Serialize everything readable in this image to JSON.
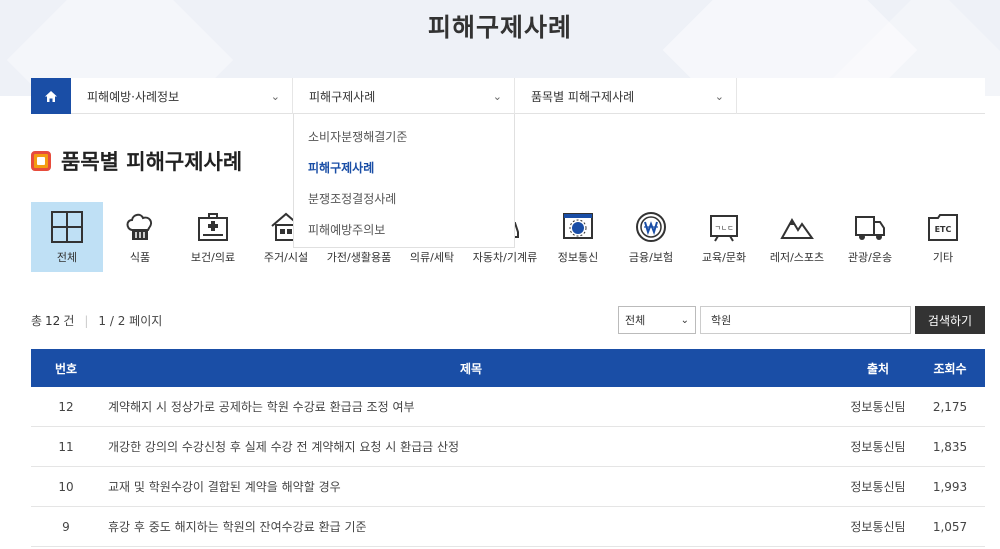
{
  "hero": {
    "title": "피해구제사례"
  },
  "breadcrumb": {
    "items": [
      {
        "label": "피해예방·사례정보"
      },
      {
        "label": "피해구제사례"
      },
      {
        "label": "품목별 피해구제사례"
      }
    ]
  },
  "dropdown": {
    "options": [
      {
        "label": "소비자분쟁해결기준"
      },
      {
        "label": "피해구제사례"
      },
      {
        "label": "분쟁조정결정사례"
      },
      {
        "label": "피해예방주의보"
      }
    ],
    "active_index": 1
  },
  "section": {
    "title": "품목별 피해구제사례"
  },
  "categories": [
    {
      "label": "전체",
      "icon": "grid-icon"
    },
    {
      "label": "식품",
      "icon": "chef-hat-icon"
    },
    {
      "label": "보건/의료",
      "icon": "medical-kit-icon"
    },
    {
      "label": "주거/시설",
      "icon": "house-icon"
    },
    {
      "label": "가전/생활용품",
      "icon": "appliance-icon"
    },
    {
      "label": "의류/세탁",
      "icon": "shirt-icon"
    },
    {
      "label": "자동차/기계류",
      "icon": "car-icon"
    },
    {
      "label": "정보통신",
      "icon": "monitor-icon"
    },
    {
      "label": "금융/보험",
      "icon": "won-coin-icon"
    },
    {
      "label": "교육/문화",
      "icon": "blackboard-icon"
    },
    {
      "label": "레저/스포츠",
      "icon": "mountain-icon"
    },
    {
      "label": "관광/운송",
      "icon": "truck-icon"
    },
    {
      "label": "기타",
      "icon": "etc-folder-icon"
    }
  ],
  "summary": {
    "total_prefix": "총",
    "total_count": "12",
    "total_suffix": "건",
    "page_info": "1 / 2 페이지"
  },
  "search": {
    "select_value": "전체",
    "input_value": "학원",
    "button_label": "검색하기"
  },
  "table": {
    "headers": {
      "no": "번호",
      "title": "제목",
      "source": "출처",
      "views": "조회수"
    },
    "rows": [
      {
        "no": "12",
        "title": "계약해지 시 정상가로 공제하는 학원 수강료 환급금 조정 여부",
        "source": "정보통신팀",
        "views": "2,175"
      },
      {
        "no": "11",
        "title": "개강한 강의의 수강신청 후 실제 수강 전 계약해지 요청 시 환급금 산정",
        "source": "정보통신팀",
        "views": "1,835"
      },
      {
        "no": "10",
        "title": "교재 및 학원수강이 결합된 계약을 해약할 경우",
        "source": "정보통신팀",
        "views": "1,993"
      },
      {
        "no": "9",
        "title": "휴강 후 중도 해지하는 학원의 잔여수강료 환급 기준",
        "source": "정보통신팀",
        "views": "1,057"
      }
    ]
  },
  "colors": {
    "primary": "#1a4ea6",
    "active_category_bg": "#bfe0f5",
    "button_dark": "#333333"
  }
}
